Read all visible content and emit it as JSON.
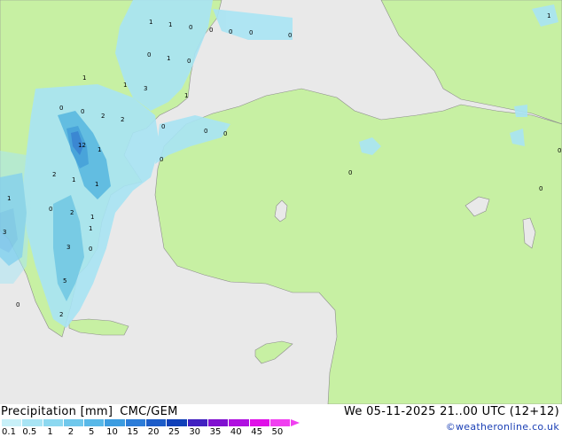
{
  "title": "Precipitation [mm]",
  "model": "CMC/GEM",
  "datetime": "We 05-11-2025 21..00 UTC (12+12)",
  "credit": "©weatheronline.co.uk",
  "legend": {
    "labels": [
      "0.1",
      "0.5",
      "1",
      "2",
      "5",
      "10",
      "15",
      "20",
      "25",
      "30",
      "35",
      "40",
      "45",
      "50"
    ],
    "colors": [
      "#c8f0f8",
      "#a8e4f4",
      "#8cd8f0",
      "#70c8ec",
      "#58b8e8",
      "#3c9ce0",
      "#2c7cd8",
      "#1c5cc8",
      "#1040b8",
      "#4020c0",
      "#8010d0",
      "#b010e0",
      "#e010e8",
      "#f040f0"
    ]
  },
  "map_labels": [
    {
      "id": "l1",
      "text": "1"
    },
    {
      "id": "l2",
      "text": "1"
    },
    {
      "id": "l3",
      "text": "0"
    },
    {
      "id": "l4",
      "text": "0"
    },
    {
      "id": "l5",
      "text": "0"
    },
    {
      "id": "l6",
      "text": "0"
    },
    {
      "id": "l7",
      "text": "0"
    },
    {
      "id": "l8",
      "text": "1"
    },
    {
      "id": "l9",
      "text": "0"
    },
    {
      "id": "l10",
      "text": "0"
    },
    {
      "id": "l11",
      "text": "1"
    },
    {
      "id": "l12",
      "text": "3"
    },
    {
      "id": "l13",
      "text": "1"
    },
    {
      "id": "l14",
      "text": "1"
    },
    {
      "id": "l15",
      "text": "0"
    },
    {
      "id": "l16",
      "text": "0"
    },
    {
      "id": "l17",
      "text": "2"
    },
    {
      "id": "l18",
      "text": "2"
    },
    {
      "id": "l19",
      "text": "0"
    },
    {
      "id": "l20",
      "text": "0"
    },
    {
      "id": "l21",
      "text": "0"
    },
    {
      "id": "l22",
      "text": "12"
    },
    {
      "id": "l23",
      "text": "1"
    },
    {
      "id": "l24",
      "text": "0"
    },
    {
      "id": "l25",
      "text": "2"
    },
    {
      "id": "l26",
      "text": "1"
    },
    {
      "id": "l27",
      "text": "1"
    },
    {
      "id": "l28",
      "text": "0"
    },
    {
      "id": "l29",
      "text": "1"
    },
    {
      "id": "l30",
      "text": "0"
    },
    {
      "id": "l31",
      "text": "2"
    },
    {
      "id": "l32",
      "text": "1"
    },
    {
      "id": "l33",
      "text": "3"
    },
    {
      "id": "l34",
      "text": "1"
    },
    {
      "id": "l35",
      "text": "3"
    },
    {
      "id": "l36",
      "text": "0"
    },
    {
      "id": "l37",
      "text": "5"
    },
    {
      "id": "l38",
      "text": "0"
    },
    {
      "id": "l39",
      "text": "2"
    },
    {
      "id": "l40",
      "text": "1"
    },
    {
      "id": "l41",
      "text": "0"
    },
    {
      "id": "l42",
      "text": "0"
    }
  ]
}
